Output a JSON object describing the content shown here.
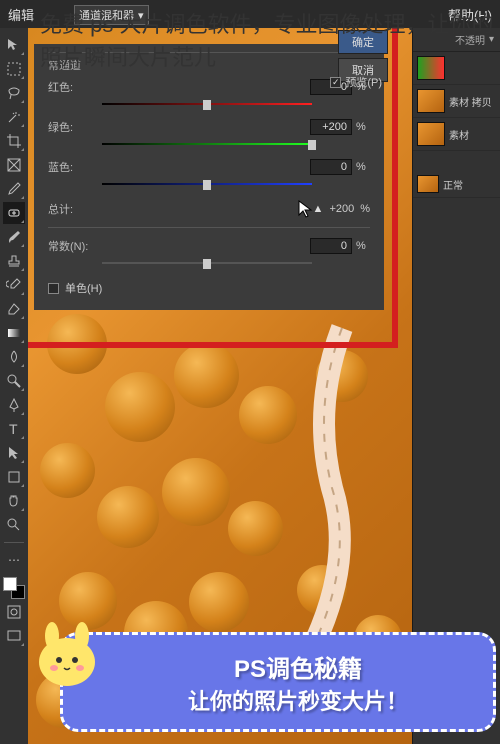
{
  "overlay_title": "免费 ps 大片调色软件，专业图像处理，让你的照片瞬间大片范儿",
  "menubar": {
    "items": [
      "编辑"
    ],
    "dropdown": "通道混和器",
    "right": [
      "帮助(H)"
    ]
  },
  "dialog": {
    "channel_label": "常通道",
    "ok": "确定",
    "cancel": "取消",
    "preview": "预览(P)",
    "red_label": "红色:",
    "red_value": "0",
    "green_label": "绿色:",
    "green_value": "+200",
    "blue_label": "蓝色:",
    "blue_value": "0",
    "total_label": "总计:",
    "total_value": "+200",
    "unit": "%",
    "constant_label": "常数(N):",
    "constant_value": "0",
    "mono_label": "单色(H)"
  },
  "right_panel": {
    "opacity_label": "不透明",
    "layers": [
      {
        "name": "素材 拷贝"
      },
      {
        "name": "素材"
      }
    ],
    "history": "正常"
  },
  "banner": {
    "title": "PS调色秘籍",
    "subtitle": "让你的照片秒变大片！"
  }
}
